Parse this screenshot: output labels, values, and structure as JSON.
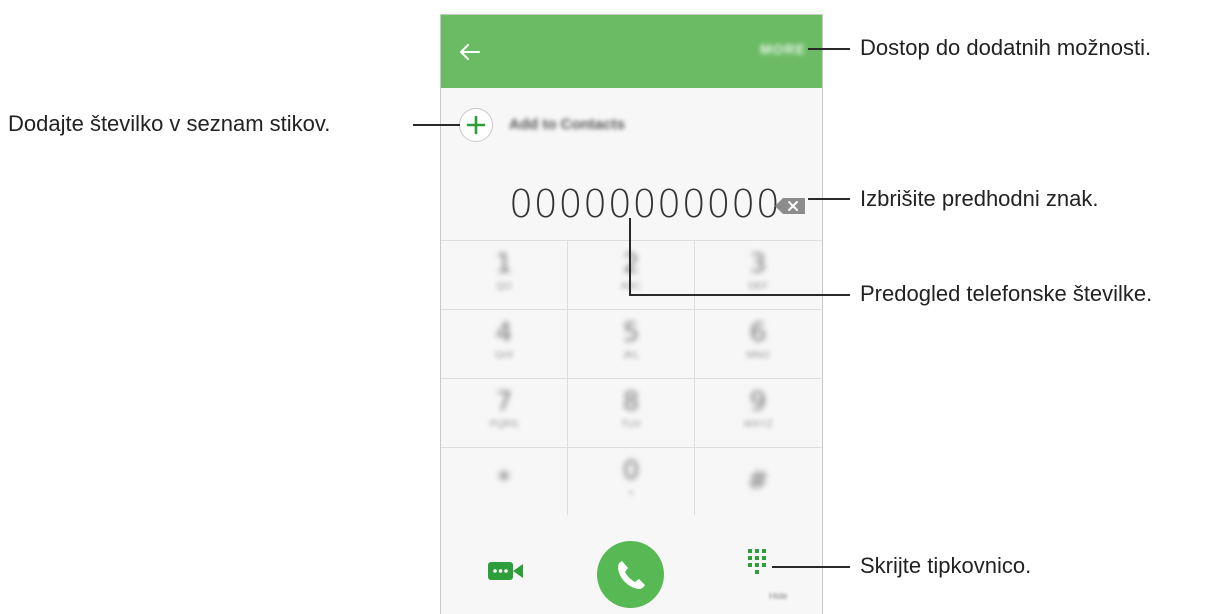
{
  "phone": {
    "appbar": {
      "more_label": "MORE"
    },
    "add_contact": {
      "label": "Add to Contacts"
    },
    "number_display": "00000000000",
    "keys": [
      {
        "digit": "1",
        "letters": "QO"
      },
      {
        "digit": "2",
        "letters": "ABC"
      },
      {
        "digit": "3",
        "letters": "DEF"
      },
      {
        "digit": "4",
        "letters": "GHI"
      },
      {
        "digit": "5",
        "letters": "JKL"
      },
      {
        "digit": "6",
        "letters": "MNO"
      },
      {
        "digit": "7",
        "letters": "PQRS"
      },
      {
        "digit": "8",
        "letters": "TUV"
      },
      {
        "digit": "9",
        "letters": "WXYZ"
      },
      {
        "digit": "*",
        "letters": ""
      },
      {
        "digit": "0",
        "letters": "+"
      },
      {
        "digit": "#",
        "letters": ""
      }
    ],
    "hide_label": "Hide",
    "colors": {
      "appbar": "#6bbb65",
      "call_button": "#56b953",
      "accent": "#2e9e3a"
    }
  },
  "callouts": {
    "more_options": "Dostop do dodatnih možnosti.",
    "add_contact": "Dodajte številko v seznam stikov.",
    "delete_char": "Izbrišite predhodni znak.",
    "preview": "Predogled telefonske številke.",
    "hide_keypad": "Skrijte tipkovnico."
  }
}
